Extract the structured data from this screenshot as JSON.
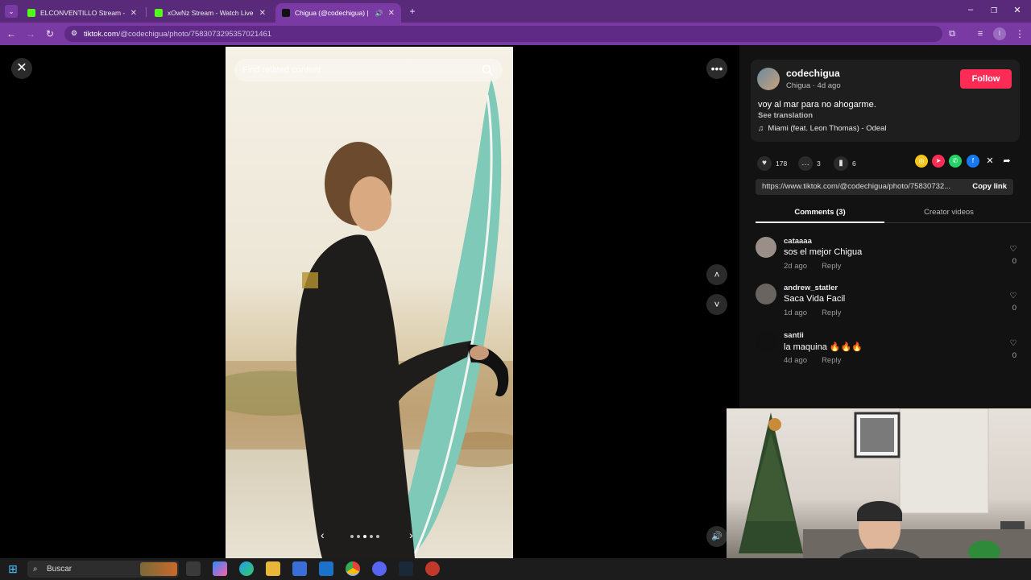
{
  "browser": {
    "tabs": [
      {
        "title": "ELCONVENTILLO Stream - Watc",
        "active": false
      },
      {
        "title": "xOwNz Stream - Watch Live on",
        "active": false
      },
      {
        "title": "Chigua (@codechigua) | Tik",
        "active": true
      }
    ],
    "url_domain": "tiktok.com",
    "url_path": "/@codechigua/photo/7583073295357021461"
  },
  "viewer": {
    "search_placeholder": "Find related content",
    "page_count": 5,
    "active_page": 3
  },
  "post": {
    "username": "codechigua",
    "display_name_date": "Chigua · 4d ago",
    "follow_label": "Follow",
    "caption": "voy al mar para no ahogarme.",
    "see_translation": "See translation",
    "music": "Miami (feat. Leon Thomas) - Odeal",
    "likes": "178",
    "comments": "3",
    "saves": "6",
    "link": "https://www.tiktok.com/@codechigua/photo/75830732...",
    "copy_link": "Copy link",
    "tabs": [
      "Comments (3)",
      "Creator videos"
    ]
  },
  "comments": [
    {
      "user": "cataaaa",
      "text": "sos el mejor Chigua",
      "date": "2d ago",
      "reply": "Reply",
      "likes": "0"
    },
    {
      "user": "andrew_statler",
      "text": "Saca Vida Facil",
      "date": "1d ago",
      "reply": "Reply",
      "likes": "0"
    },
    {
      "user": "santii",
      "text": "la maquina 🔥🔥🔥",
      "date": "4d ago",
      "reply": "Reply",
      "likes": "0"
    }
  ],
  "taskbar": {
    "search_label": "Buscar"
  },
  "colors": {
    "accent": "#fe2c55",
    "browser_frame": "#7a3aa3"
  }
}
